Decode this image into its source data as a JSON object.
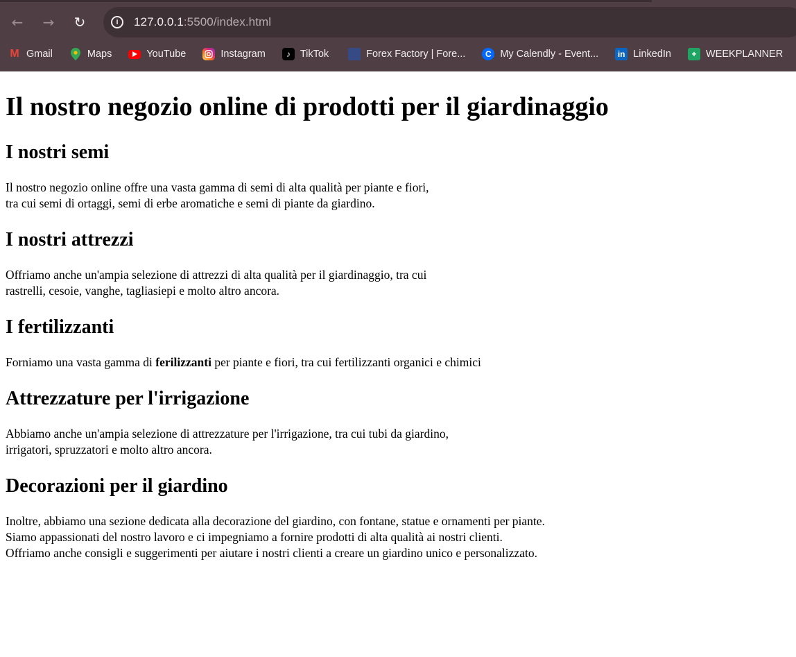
{
  "browser": {
    "url_host": "127.0.0.1",
    "url_rest": ":5500/index.html",
    "bookmarks": [
      {
        "label": "Gmail",
        "icon": "gmail-icon"
      },
      {
        "label": "Maps",
        "icon": "maps-icon"
      },
      {
        "label": "YouTube",
        "icon": "youtube-icon"
      },
      {
        "label": "Instagram",
        "icon": "instagram-icon"
      },
      {
        "label": "TikTok",
        "icon": "tiktok-icon"
      },
      {
        "label": "Forex Factory | Fore...",
        "icon": "forex-factory-icon"
      },
      {
        "label": "My Calendly - Event...",
        "icon": "calendly-icon"
      },
      {
        "label": "LinkedIn",
        "icon": "linkedin-icon"
      },
      {
        "label": "WEEKPLANNER",
        "icon": "weekplanner-icon"
      }
    ]
  },
  "page": {
    "title": "Il nostro negozio online di prodotti per il giardinaggio",
    "sections": [
      {
        "heading": "I nostri semi",
        "lines": [
          "Il nostro negozio online offre una vasta gamma di semi di alta qualità per piante e fiori,",
          "tra cui semi di ortaggi, semi di erbe aromatiche e semi di piante da giardino."
        ]
      },
      {
        "heading": "I nostri attrezzi",
        "lines": [
          "Offriamo anche un'ampia selezione di attrezzi di alta qualità per il giardinaggio, tra cui",
          "rastrelli, cesoie, vanghe, tagliasiepi e molto altro ancora."
        ]
      },
      {
        "heading": "I fertilizzanti",
        "text_before": "Forniamo una vasta gamma di",
        "bold": "ferilizzanti",
        "text_after": "per piante e fiori, tra cui fertilizzanti organici e chimici"
      },
      {
        "heading": "Attrezzature per l'irrigazione",
        "lines": [
          "Abbiamo anche un'ampia selezione di attrezzature per l'irrigazione, tra cui tubi da giardino,",
          "irrigatori, spruzzatori e molto altro ancora."
        ]
      },
      {
        "heading": "Decorazioni per il giardino",
        "lines": [
          "Inoltre, abbiamo una sezione dedicata alla decorazione del giardino, con fontane, statue e ornamenti per piante.",
          "Siamo appassionati del nostro lavoro e ci impegniamo a fornire prodotti di alta qualità ai nostri clienti.",
          "Offriamo anche consigli e suggerimenti per aiutare i nostri clienti a creare un giardino unico e personalizzato."
        ]
      }
    ]
  }
}
